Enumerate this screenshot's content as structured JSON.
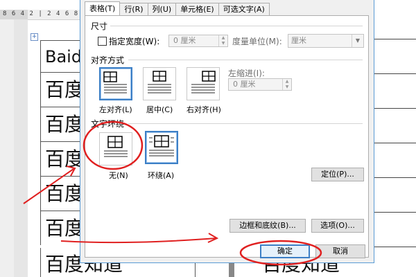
{
  "ruler_text": "8 6 4 2  | 2 4 6 8 1",
  "document": {
    "left_cells": [
      "Baid",
      "百度",
      "百度",
      "百度",
      "百度",
      "百度"
    ],
    "bottom_left_text": "百度知道",
    "bottom_right_text": "百度知道"
  },
  "dialog": {
    "tabs": [
      {
        "label": "表格(T)",
        "active": true
      },
      {
        "label": "行(R)",
        "active": false
      },
      {
        "label": "列(U)",
        "active": false
      },
      {
        "label": "单元格(E)",
        "active": false
      },
      {
        "label": "可选文字(A)",
        "active": false
      }
    ],
    "size_section": {
      "title": "尺寸",
      "specify_width_label": "指定宽度(W):",
      "width_value": "0 厘米",
      "measure_label": "度量单位(M):",
      "measure_value": "厘米"
    },
    "alignment_section": {
      "title": "对齐方式",
      "options": [
        {
          "label": "左对齐(L)",
          "icon": "align-left-icon",
          "selected": true
        },
        {
          "label": "居中(C)",
          "icon": "align-center-icon",
          "selected": false
        },
        {
          "label": "右对齐(H)",
          "icon": "align-right-icon",
          "selected": false
        }
      ],
      "indent_label": "左缩进(I):",
      "indent_value": "0 厘米"
    },
    "wrap_section": {
      "title": "文字环绕",
      "options": [
        {
          "label": "无(N)",
          "icon": "wrap-none-icon",
          "selected": false
        },
        {
          "label": "环绕(A)",
          "icon": "wrap-around-icon",
          "selected": true
        }
      ],
      "position_button": "定位(P)..."
    },
    "borders_button": "边框和底纹(B)...",
    "options_button": "选项(O)...",
    "ok_button": "确定",
    "cancel_button": "取消"
  },
  "colors": {
    "accent": "#3c7fc6",
    "annotation_red": "#e02020",
    "dialog_bg": "#f0f0f0"
  }
}
